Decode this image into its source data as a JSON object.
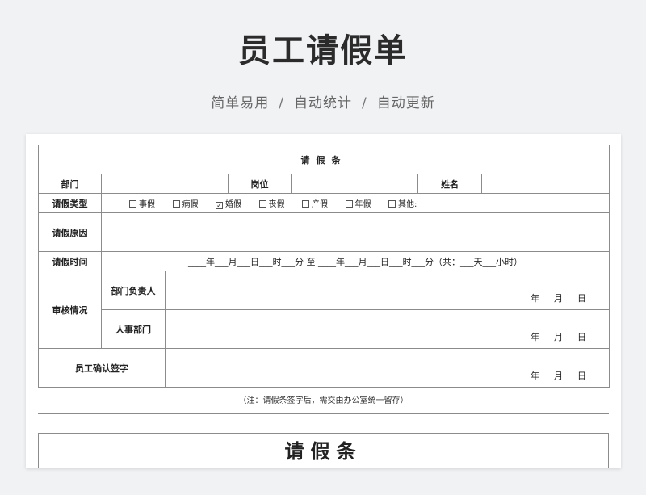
{
  "header": {
    "title": "员工请假单",
    "subtitle_parts": [
      "简单易用",
      "自动统计",
      "自动更新"
    ],
    "separator": "/"
  },
  "form": {
    "title": "请假条",
    "labels": {
      "department": "部门",
      "position": "岗位",
      "name": "姓名",
      "leave_type": "请假类型",
      "reason": "请假原因",
      "time": "请假时间",
      "review": "审核情况",
      "dept_head": "部门负责人",
      "hr_dept": "人事部门",
      "employee_sign": "员工确认签字"
    },
    "leave_types": [
      {
        "label": "事假",
        "checked": false
      },
      {
        "label": "病假",
        "checked": false
      },
      {
        "label": "婚假",
        "checked": true
      },
      {
        "label": "丧假",
        "checked": false
      },
      {
        "label": "产假",
        "checked": false
      },
      {
        "label": "年假",
        "checked": false
      },
      {
        "label": "其他:",
        "checked": false
      }
    ],
    "check_mark": "✓",
    "time_text": "____年___月___日___时___分 至 ____年___月___日___时___分（共：___天___小时）",
    "date_labels": {
      "year": "年",
      "month": "月",
      "day": "日"
    },
    "note": "（注：请假条签字后，需交由办公室统一留存）"
  },
  "form2": {
    "title": "请假条"
  },
  "colors": {
    "background": "#f1f2f4",
    "border": "#8c8c8c"
  }
}
